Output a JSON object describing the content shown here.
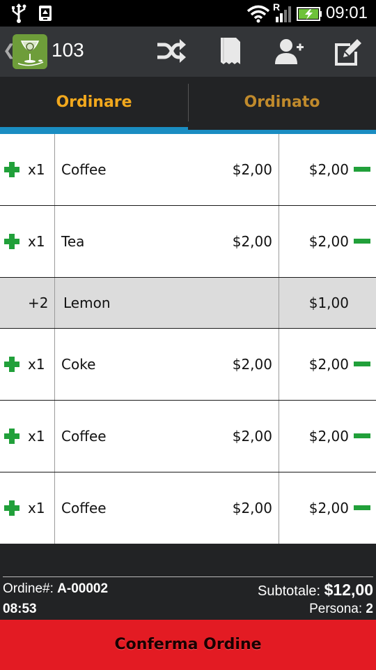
{
  "status_bar": {
    "time": "09:01",
    "network_label": "R",
    "icons": [
      "usb-icon",
      "android-debug-icon",
      "wifi-icon",
      "signal-icon",
      "battery-charging-icon"
    ]
  },
  "action_bar": {
    "table_number": "103",
    "buttons": [
      "shuffle-icon",
      "receipt-icon",
      "add-person-icon",
      "edit-icon"
    ]
  },
  "tabs": {
    "active": "Ordinare",
    "inactive": "Ordinato",
    "active_color": "#f2a81d",
    "inactive_color": "#c08a2c"
  },
  "order_items": [
    {
      "qty": "x1",
      "name": "Coffee",
      "price": "$2,00",
      "total": "$2,00"
    },
    {
      "qty": "x1",
      "name": "Tea",
      "price": "$2,00",
      "total": "$2,00"
    },
    {
      "qty": "+2",
      "name": "Lemon",
      "price": "",
      "total": "$1,00",
      "modifier": true
    },
    {
      "qty": "x1",
      "name": "Coke",
      "price": "$2,00",
      "total": "$2,00"
    },
    {
      "qty": "x1",
      "name": "Coffee",
      "price": "$2,00",
      "total": "$2,00"
    },
    {
      "qty": "x1",
      "name": "Coffee",
      "price": "$2,00",
      "total": "$2,00"
    }
  ],
  "footer": {
    "order_label": "Ordine#:",
    "order_number": "A-00002",
    "time": "08:53",
    "subtotal_label": "Subtotale:",
    "subtotal_value": "$12,00",
    "persons_label": "Persona:",
    "persons_value": "2"
  },
  "confirm_button": {
    "label": "Conferma Ordine",
    "color": "#e31b23"
  }
}
